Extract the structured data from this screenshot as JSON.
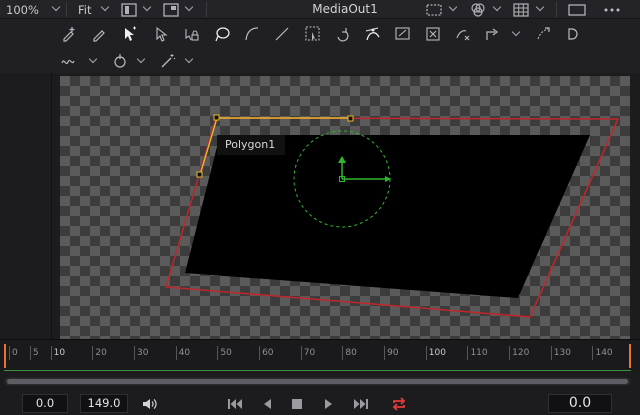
{
  "header": {
    "zoom_value": "100%",
    "fit_value": "Fit",
    "viewer_title": "MediaOut1",
    "more_icon": "more-dots-icon"
  },
  "viewer": {
    "polygon_label": "Polygon1",
    "colors": {
      "polygon_outline": "#c0262b",
      "spline": "#e7b92b",
      "transform_widget": "#2cb82c"
    }
  },
  "timeline": {
    "ticks": [
      {
        "label": "0"
      },
      {
        "label": "5"
      },
      {
        "label": "10",
        "major": true
      },
      {
        "label": "20"
      },
      {
        "label": "30"
      },
      {
        "label": "40"
      },
      {
        "label": "50"
      },
      {
        "label": "60"
      },
      {
        "label": "70"
      },
      {
        "label": "80"
      },
      {
        "label": "90"
      },
      {
        "label": "100",
        "major": true
      },
      {
        "label": "110"
      },
      {
        "label": "120"
      },
      {
        "label": "130"
      },
      {
        "label": "140"
      }
    ],
    "render_start": "0.0",
    "render_end": "149.0",
    "current_time": "0.0",
    "accent_color": "#e4782a"
  }
}
